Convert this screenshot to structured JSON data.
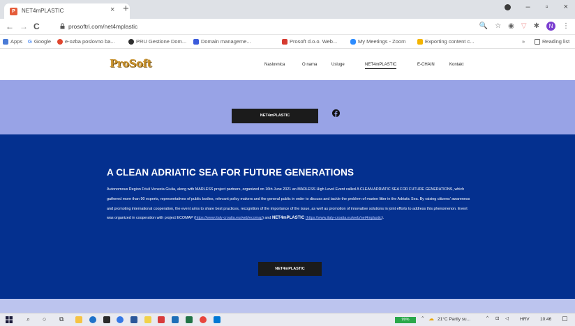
{
  "browser": {
    "tab_title": "NET4mPLASTIC",
    "tab_close": "×",
    "new_tab": "+",
    "minimize": "–",
    "maximize": "▫",
    "close": "×",
    "back": "←",
    "forward": "→",
    "reload": "C",
    "url": "prosoftri.com/net4mplastic",
    "profile_initial": "N",
    "bookmarks": [
      {
        "label": "Apps",
        "icon": "apps-grid-icon",
        "color": "#4a7bd6"
      },
      {
        "label": "Google",
        "icon": "google-icon",
        "color": "#4285f4"
      },
      {
        "label": "e-ozba poslovno ba...",
        "icon": "bookmark-icon",
        "color": "#e0462f"
      },
      {
        "label": "PRU Gestione Dom...",
        "icon": "bookmark-icon",
        "color": "#2f2f2f"
      },
      {
        "label": "Domain manageme...",
        "icon": "bookmark-icon",
        "color": "#3b5bdb"
      },
      {
        "label": "Prosoft d.o.o. Web...",
        "icon": "bookmark-icon",
        "color": "#d63a2f"
      },
      {
        "label": "My Meetings - Zoom",
        "icon": "zoom-icon",
        "color": "#2d8cff"
      },
      {
        "label": "Exporting content c...",
        "icon": "bookmark-icon",
        "color": "#f4b400"
      },
      {
        "label": "»",
        "icon": "",
        "color": ""
      },
      {
        "label": "Reading list",
        "icon": "reading-list-icon",
        "color": "#666666"
      }
    ]
  },
  "site": {
    "logo": "ProSoft",
    "nav": [
      "Naslovnica",
      "O nama",
      "Usluge",
      "NET4mPLASTIC",
      "E-CHAIN",
      "Kontakt"
    ],
    "active_nav": "NET4mPLASTIC",
    "top_button": "NET4mPLASTIC",
    "heading": "A CLEAN ADRIATIC SEA FOR FUTURE GENERATIONS",
    "paragraph_text": "Autonomous Region Friuli Venezia Giulia, along with MARLESS project partners, organized on 16th June 2021 an MARLESS High Level Event called A CLEAN ADRIATIC SEA FOR FUTURE GENERATIONS, which gathered more than 90 experts, representatives of public bodies, relevant policy makers and the general public in order to discuss and tackle the problem of marine litter in the Adriatic Sea. By raising citizens' awareness and promoting international cooperation, the event aims to share best practices, recognition of the importance of the issue, as well as promotion of innovative solutions in joint efforts to address this phenomenon. Event was organized in cooperation with project ECOMAP (",
    "link_ecomap": "https://www.italy-croatia.eu/web/ecomap",
    "paragraph_mid": ") and ",
    "bold_project": "NET4mPLASTIC",
    "link_net4m": "(https://www.italy-croatia.eu/web/net4mplastic",
    "paragraph_end": ").",
    "bottom_button": "NET4mPLASTIC",
    "colors": {
      "band_light": "#98a3e6",
      "band_blue": "#04308f",
      "button": "#1b1b1b"
    }
  },
  "taskbar": {
    "battery": "99%",
    "weather": "21°C Partly su...",
    "language": "HRV",
    "time": "10:46"
  }
}
